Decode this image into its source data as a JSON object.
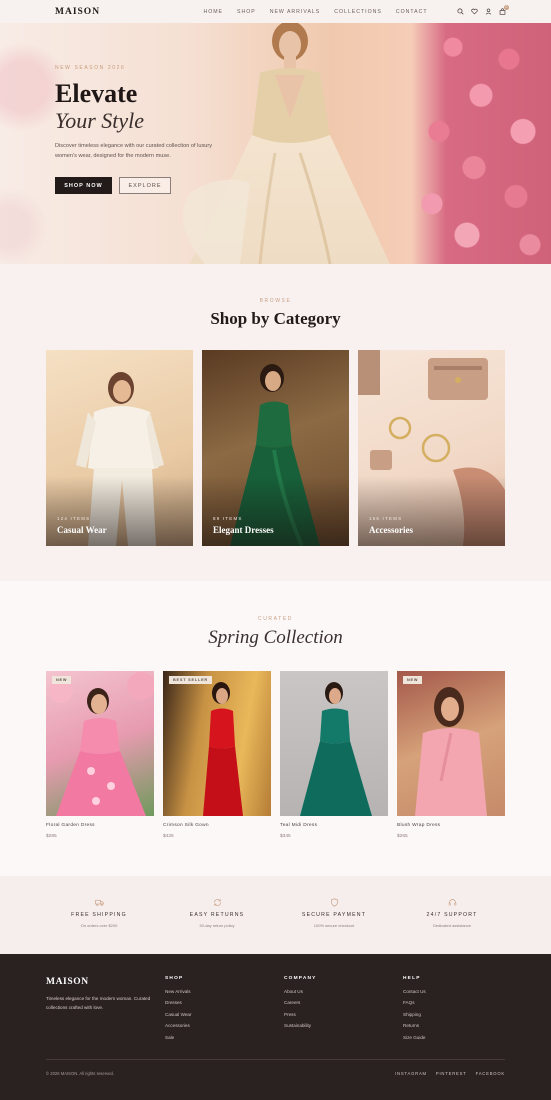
{
  "brand": "MAISON",
  "nav": {
    "links": [
      "HOME",
      "SHOP",
      "NEW ARRIVALS",
      "COLLECTIONS",
      "CONTACT"
    ],
    "cart_count": "0"
  },
  "hero": {
    "eyebrow": "NEW SEASON 2026",
    "title_line1": "Elevate",
    "title_line2": "Your Style",
    "description": "Discover timeless elegance with our curated collection of luxury women's wear, designed for the modern muse.",
    "primary_cta": "SHOP NOW",
    "secondary_cta": "EXPLORE"
  },
  "categories_section": {
    "eyebrow": "BROWSE",
    "title": "Shop by Category",
    "items": [
      {
        "count": "124 ITEMS",
        "name": "Casual Wear"
      },
      {
        "count": "89 ITEMS",
        "name": "Elegant Dresses"
      },
      {
        "count": "156 ITEMS",
        "name": "Accessories"
      }
    ]
  },
  "spring_section": {
    "eyebrow": "CURATED",
    "title": "Spring Collection",
    "products": [
      {
        "badge": "NEW",
        "name": "Floral Garden Dress",
        "price": "$285"
      },
      {
        "badge": "BEST SELLER",
        "name": "Crimson Silk Gown",
        "price": "$425"
      },
      {
        "badge": "",
        "name": "Teal Midi Dress",
        "price": "$345"
      },
      {
        "badge": "NEW",
        "name": "Blush Wrap Dress",
        "price": "$265"
      }
    ]
  },
  "features": [
    {
      "icon": "truck-icon",
      "title": "FREE SHIPPING",
      "sub": "On orders over $200"
    },
    {
      "icon": "refresh-icon",
      "title": "EASY RETURNS",
      "sub": "30-day return policy"
    },
    {
      "icon": "shield-icon",
      "title": "SECURE PAYMENT",
      "sub": "100% secure checkout"
    },
    {
      "icon": "headset-icon",
      "title": "24/7 SUPPORT",
      "sub": "Dedicated assistance"
    }
  ],
  "footer": {
    "logo": "MAISON",
    "tagline": "Timeless elegance for the modern woman. Curated collections crafted with love.",
    "columns": [
      {
        "head": "SHOP",
        "links": [
          "New Arrivals",
          "Dresses",
          "Casual Wear",
          "Accessories",
          "Sale"
        ]
      },
      {
        "head": "COMPANY",
        "links": [
          "About Us",
          "Careers",
          "Press",
          "Sustainability"
        ]
      },
      {
        "head": "HELP",
        "links": [
          "Contact Us",
          "FAQs",
          "Shipping",
          "Returns",
          "Size Guide"
        ]
      }
    ],
    "copyright": "© 2026 MAISON. All rights reserved.",
    "social": [
      "INSTAGRAM",
      "PINTEREST",
      "FACEBOOK"
    ]
  },
  "colors": {
    "accent": "#c99f84",
    "dark": "#221b1a",
    "footer_bg": "#2a2221"
  }
}
